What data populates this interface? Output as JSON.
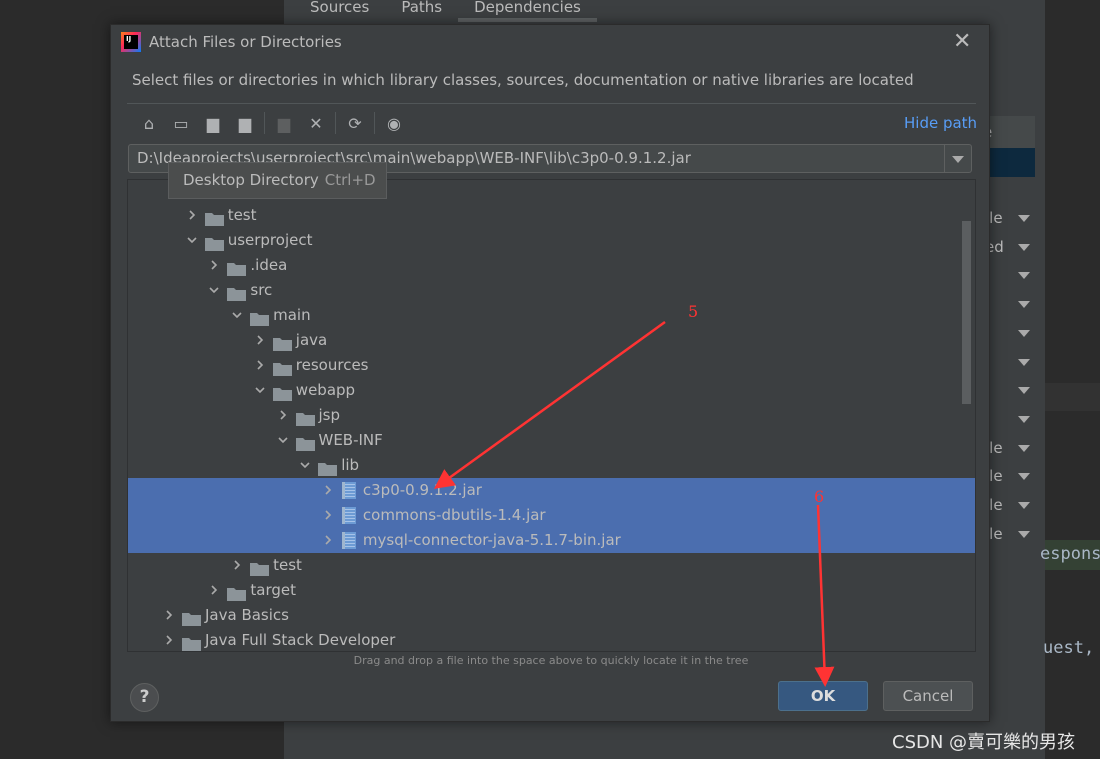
{
  "ide": {
    "tabs": [
      "Sources",
      "Paths",
      "Dependencies"
    ],
    "active_tab": "Dependencies",
    "column_header_fragment": "e",
    "dropdown_fragments": [
      "ile",
      "ed",
      "",
      "",
      "",
      "",
      "",
      "",
      "ile",
      "ile",
      "ile",
      "ile"
    ],
    "code_fragments": [
      "espons",
      "uest,"
    ]
  },
  "dialog": {
    "title": "Attach Files or Directories",
    "description": "Select files or directories in which library classes, sources, documentation or native libraries are located",
    "toolbar_icons": [
      "home-icon",
      "desktop-icon",
      "project-folder-icon",
      "module-folder-icon",
      "new-folder-icon",
      "delete-icon",
      "refresh-icon",
      "show-hidden-icon"
    ],
    "hide_path": "Hide path",
    "path_value": "D:\\Ideaprojects\\userproject\\src\\main\\webapp\\WEB-INF\\lib\\c3p0-0.9.1.2.jar",
    "tooltip": {
      "label": "Desktop Directory",
      "shortcut": "Ctrl+D"
    },
    "tree": [
      {
        "label": "test",
        "level": 1,
        "expanded": false,
        "type": "folder"
      },
      {
        "label": "userproject",
        "level": 1,
        "expanded": true,
        "type": "folder"
      },
      {
        "label": ".idea",
        "level": 2,
        "expanded": false,
        "type": "folder"
      },
      {
        "label": "src",
        "level": 2,
        "expanded": true,
        "type": "folder"
      },
      {
        "label": "main",
        "level": 3,
        "expanded": true,
        "type": "folder"
      },
      {
        "label": "java",
        "level": 4,
        "expanded": false,
        "type": "folder"
      },
      {
        "label": "resources",
        "level": 4,
        "expanded": false,
        "type": "folder"
      },
      {
        "label": "webapp",
        "level": 4,
        "expanded": true,
        "type": "folder"
      },
      {
        "label": "jsp",
        "level": 5,
        "expanded": false,
        "type": "folder"
      },
      {
        "label": "WEB-INF",
        "level": 5,
        "expanded": true,
        "type": "folder"
      },
      {
        "label": "lib",
        "level": 6,
        "expanded": true,
        "type": "folder"
      },
      {
        "label": "c3p0-0.9.1.2.jar",
        "level": 7,
        "expanded": false,
        "type": "jar",
        "selected": true
      },
      {
        "label": "commons-dbutils-1.4.jar",
        "level": 7,
        "expanded": false,
        "type": "jar",
        "selected": true
      },
      {
        "label": "mysql-connector-java-5.1.7-bin.jar",
        "level": 7,
        "expanded": false,
        "type": "jar",
        "selected": true
      },
      {
        "label": "test",
        "level": 3,
        "expanded": false,
        "type": "folder"
      },
      {
        "label": "target",
        "level": 2,
        "expanded": false,
        "type": "folder"
      },
      {
        "label": "Java Basics",
        "level": 0,
        "expanded": false,
        "type": "folder"
      },
      {
        "label": "Java Full Stack Developer",
        "level": 0,
        "expanded": false,
        "type": "folder"
      }
    ],
    "hint": "Drag and drop a file into the space above to quickly locate it in the tree",
    "help": "?",
    "ok": "OK",
    "cancel": "Cancel"
  },
  "annotations": [
    "5",
    "6"
  ],
  "annotation_color": "#ff3333",
  "selection_color": "#4b6eaf",
  "watermark": "CSDN @賣可樂的男孩"
}
